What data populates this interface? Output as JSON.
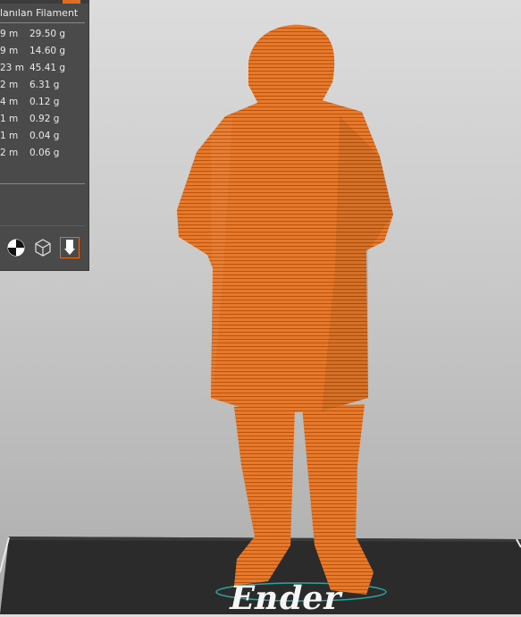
{
  "panel": {
    "header": "lanılan Filament",
    "rows": [
      {
        "length": "9 m",
        "weight": "29.50 g"
      },
      {
        "length": "9 m",
        "weight": "14.60 g"
      },
      {
        "length": "23 m",
        "weight": "45.41 g"
      },
      {
        "length": "2 m",
        "weight": "6.31 g"
      },
      {
        "length": "4 m",
        "weight": "0.12 g"
      },
      {
        "length": "1 m",
        "weight": "0.92 g"
      },
      {
        "length": "1 m",
        "weight": "0.04 g"
      },
      {
        "length": "2 m",
        "weight": "0.06 g"
      }
    ],
    "view_buttons": [
      "view-solid-icon",
      "view-wireframe-icon",
      "view-toolpath-icon"
    ]
  },
  "bed": {
    "brand": "Ender"
  },
  "colors": {
    "accent": "#e26c1f",
    "model": "#e0732a",
    "panel_bg": "#4a4a4a",
    "bed": "#2b2b2b"
  }
}
